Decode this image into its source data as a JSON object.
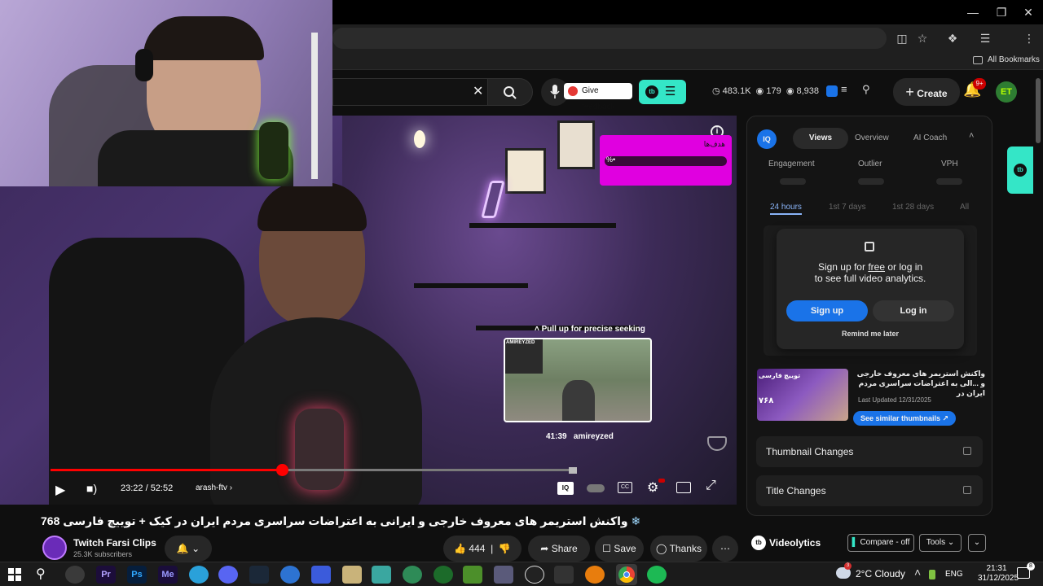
{
  "browser": {
    "bookmarks_label": "All Bookmarks"
  },
  "youtube": {
    "feedback_label": "Give feedback",
    "stats": {
      "views": "483.1K",
      "eye": "179",
      "likes": "8,938"
    },
    "create_label": "Create",
    "notif_count": "9+"
  },
  "player": {
    "time": "23:22 / 52:52",
    "chapter": "arash-ftv",
    "seek_hint": "Pull up for precise seeking",
    "preview_time": "41:39",
    "preview_label": "amireyzed",
    "preview_cam_name": "AMIREYZED",
    "progress_fraction": 0.44,
    "overlay_title": "هدف‌ها",
    "overlay_pct": "%•"
  },
  "video": {
    "title": "واکنش استریمر های معروف خارجی و ایرانی به اعتراضات سراسری مردم ایران در کیک + توییچ فارسی 768",
    "channel": "Twitch Farsi Clips",
    "subscribers": "25.3K subscribers",
    "likes": "444",
    "share_label": "Share",
    "save_label": "Save",
    "thanks_label": "Thanks"
  },
  "panel": {
    "tabs": [
      "Views",
      "Overview",
      "AI Coach"
    ],
    "metrics": [
      "Engagement",
      "Outlier",
      "VPH"
    ],
    "ranges": [
      "24 hours",
      "1st 7 days",
      "1st 28 days",
      "All"
    ],
    "signup_text_1": "Sign up for",
    "signup_free": "free",
    "signup_text_2": "or log in",
    "signup_text_3": "to see full video analytics.",
    "signup_button": "Sign up",
    "login_button": "Log in",
    "remind_label": "Remind me later",
    "thumb_title": "واکنش استریمر های معروف خارجی و ...الی به اعتراضات سراسری مردم ایران در",
    "last_updated": "Last Updated 12/31/2025",
    "similar_label": "See similar thumbnails",
    "thumb_badge": "۷۶۸",
    "thumb_text": "توییچ فارسی",
    "thumbnail_changes": "Thumbnail Changes",
    "title_changes": "Title Changes",
    "brand": "Videolytics",
    "compare_label": "Compare - off",
    "tools_label": "Tools"
  },
  "taskbar": {
    "weather": "2°C  Cloudy",
    "weather_badge": "3",
    "lang": "ENG",
    "time": "21:31",
    "date": "31/12/2025",
    "apps": [
      "Pr",
      "Ps",
      "Me",
      "",
      "",
      "",
      "",
      "",
      "",
      "",
      "",
      "",
      "",
      "",
      "",
      "",
      "",
      ""
    ]
  },
  "colors": {
    "accent_red": "#ff0000",
    "vidiq_teal": "#34e6c7",
    "signup_blue": "#1a73e8",
    "magenta": "#e000e0"
  }
}
